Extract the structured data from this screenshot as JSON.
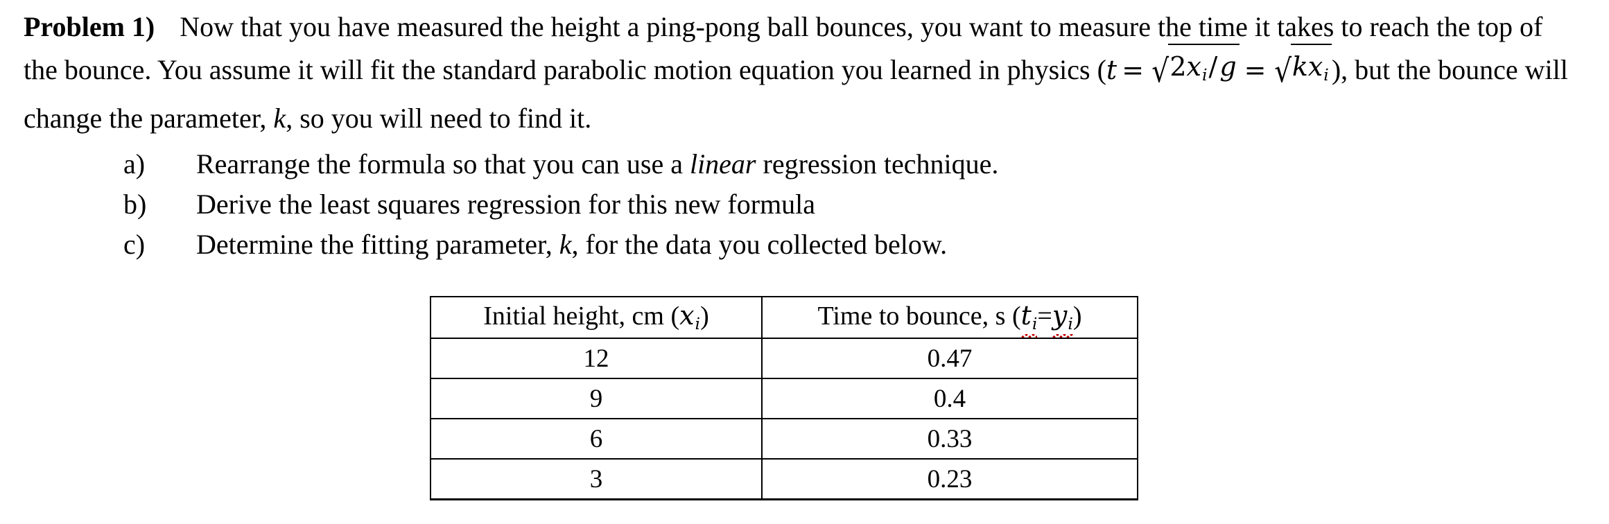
{
  "document": {
    "problem": {
      "label": "Problem 1)",
      "intro_part1": "Now that you have measured the height a ping-pong ball bounces, you want to measure the time it takes to reach the top of the bounce. You assume it will fit the standard parabolic motion equation you learned in physics (",
      "equation": {
        "lhs": "t",
        "equals1": "=",
        "radical1": {
          "coefficient": "2",
          "variable": "x",
          "subscript": "i",
          "divider": "/",
          "denominator": "g"
        },
        "equals2": "=",
        "radical2": {
          "parameter": "k",
          "variable": "x",
          "subscript": "i"
        }
      },
      "intro_part2_a": "), but the bounce will change the parameter, ",
      "intro_param": "k",
      "intro_part2_b": ", so you will need to find it."
    },
    "sub_questions": [
      {
        "marker": "a)",
        "text_before": "Rearrange the formula so that you can use a ",
        "emphasis": "linear",
        "text_after": " regression technique."
      },
      {
        "marker": "b)",
        "text_before": "Derive the least squares regression for this new formula",
        "emphasis": "",
        "text_after": ""
      },
      {
        "marker": "c)",
        "text_before": "Determine the fitting parameter, ",
        "emphasis": "k",
        "text_after": ", for the data you collected below."
      }
    ],
    "table": {
      "headers": [
        {
          "text": "Initial height, cm ",
          "open_paren": "(",
          "symbol": "x",
          "subscript": "i",
          "close_paren": ")",
          "misspelled": false
        },
        {
          "text": "Time to bounce, s ",
          "open_paren": "(",
          "symbol_1": "t",
          "subscript_1": "i",
          "equals": "=",
          "symbol_2": "y",
          "subscript_2": "i",
          "close_paren": ")",
          "misspelled": true
        }
      ],
      "rows": [
        {
          "initial_height_cm": "12",
          "time_to_bounce_s": "0.47"
        },
        {
          "initial_height_cm": "9",
          "time_to_bounce_s": "0.4"
        },
        {
          "initial_height_cm": "6",
          "time_to_bounce_s": "0.33"
        },
        {
          "initial_height_cm": "3",
          "time_to_bounce_s": "0.23"
        }
      ]
    },
    "colors": {
      "text": "#000000",
      "background": "#ffffff",
      "spellcheck_underline": "#c00000",
      "table_border": "#000000"
    }
  }
}
